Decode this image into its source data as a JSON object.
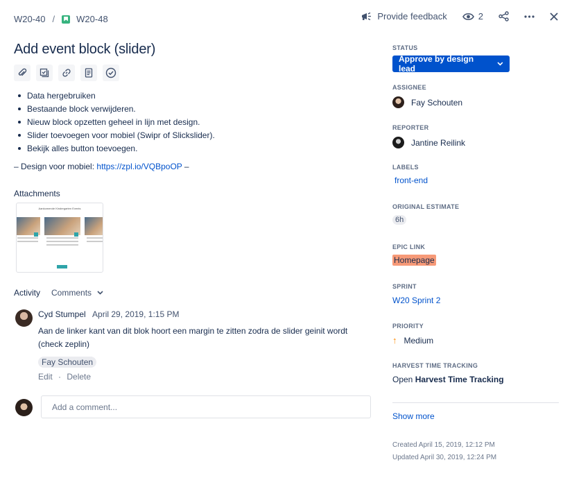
{
  "header": {
    "breadcrumb_parent": "W20-40",
    "breadcrumb_separator": "/",
    "breadcrumb_current": "W20-48",
    "feedback_label": "Provide feedback",
    "watchers_count": "2"
  },
  "issue": {
    "title": "Add event block (slider)",
    "description_items": [
      "Data hergebruiken",
      "Bestaande block verwijderen.",
      "Nieuw block opzetten geheel in lijn met design.",
      "Slider toevoegen voor mobiel (Swipr of Slickslider).",
      "Bekijk alles button toevoegen."
    ],
    "design_prefix": "– Design voor mobiel: ",
    "design_link": "https://zpl.io/VQBpoOP",
    "design_suffix": " –"
  },
  "attachments": {
    "title": "Attachments",
    "thumbnail_title": "Aankomende Kindergarten Events"
  },
  "activity": {
    "label": "Activity",
    "filter": "Comments",
    "comment": {
      "author": "Cyd Stumpel",
      "date": "April 29, 2019, 1:15 PM",
      "body": "Aan de linker kant van dit blok hoort een margin te zitten zodra de slider geinit wordt (check zeplin)",
      "mention": "Fay Schouten",
      "edit": "Edit",
      "delete": "Delete",
      "separator": "·"
    },
    "add_comment_placeholder": "Add a comment..."
  },
  "sidebar": {
    "status_label": "STATUS",
    "status_value": "Approve by design lead",
    "assignee_label": "ASSIGNEE",
    "assignee": "Fay Schouten",
    "reporter_label": "REPORTER",
    "reporter": "Jantine Reilink",
    "labels_label": "LABELS",
    "label_value": "front-end",
    "estimate_label": "ORIGINAL ESTIMATE",
    "estimate_value": "6h",
    "epic_label": "EPIC LINK",
    "epic_value": "Homepage",
    "sprint_label": "SPRINT",
    "sprint_value": "W20 Sprint 2",
    "priority_label": "PRIORITY",
    "priority_value": "Medium",
    "harvest_label": "HARVEST TIME TRACKING",
    "harvest_prefix": "Open",
    "harvest_strong": "Harvest Time Tracking",
    "show_more": "Show more",
    "created": "Created April 15, 2019, 12:12 PM",
    "updated": "Updated April 30, 2019, 12:24 PM"
  },
  "colors": {
    "primary": "#0052CC",
    "epic": "#F79A78",
    "story": "#36B37E",
    "priority_medium": "#FF8B00"
  }
}
